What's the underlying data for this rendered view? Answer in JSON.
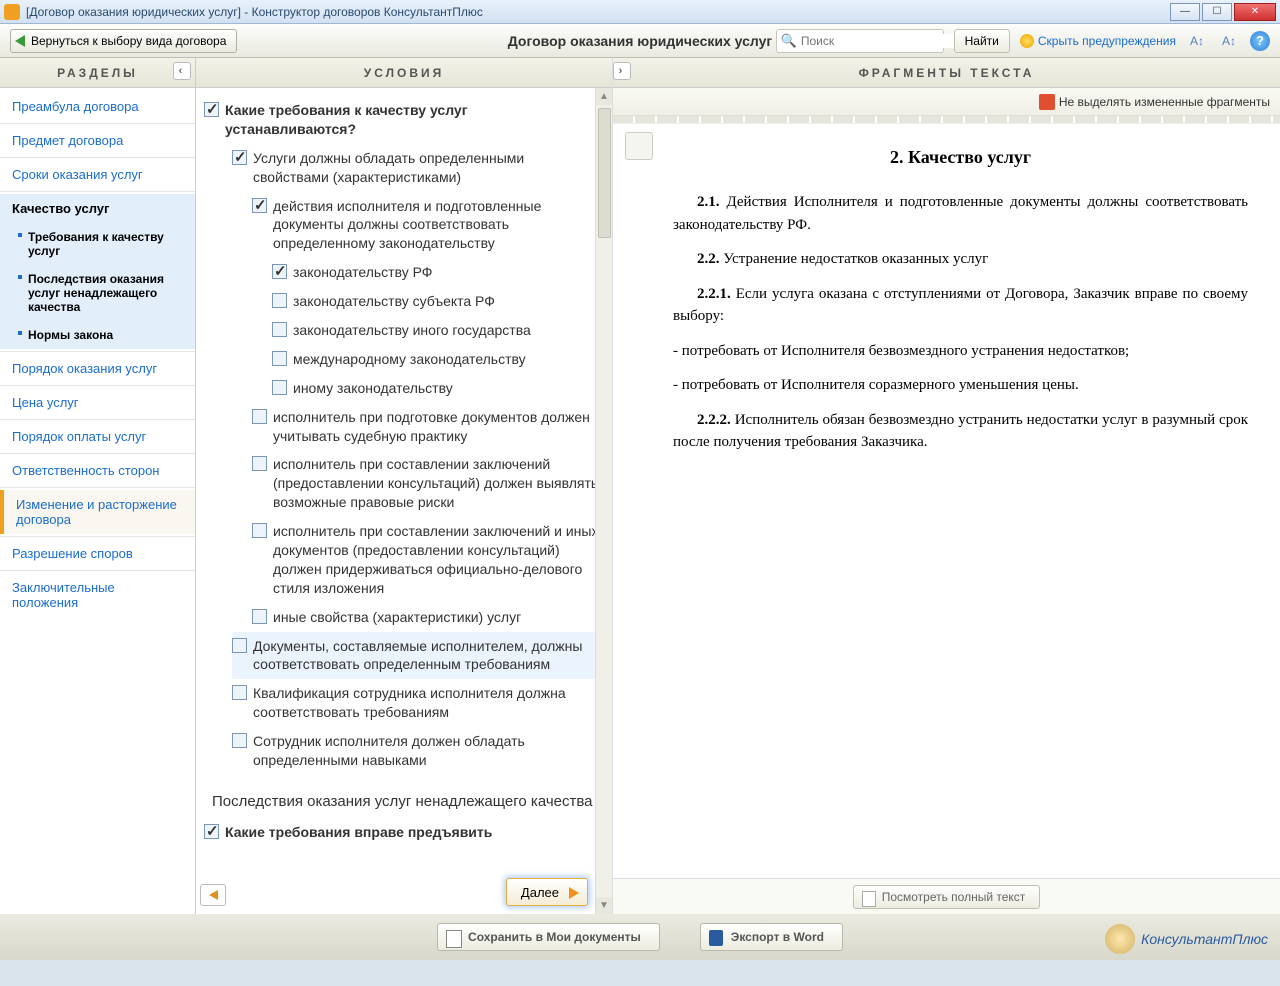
{
  "window": {
    "title": "[Договор оказания юридических услуг] - Конструктор договоров КонсультантПлюс"
  },
  "toolbar": {
    "back": "Вернуться к выбору вида договора",
    "title": "Договор оказания юридических услуг",
    "search_placeholder": "Поиск",
    "find": "Найти",
    "hide_warnings": "Скрыть предупреждения",
    "help": "?"
  },
  "panel_headers": {
    "sections": "РАЗДЕЛЫ",
    "conditions": "УСЛОВИЯ",
    "fragments": "ФРАГМЕНТЫ  ТЕКСТА"
  },
  "sections": [
    {
      "label": "Преамбула договора"
    },
    {
      "label": "Предмет договора"
    },
    {
      "label": "Сроки оказания услуг"
    },
    {
      "label": "Качество услуг",
      "active": true,
      "subs": [
        {
          "label": "Требования к качеству услуг"
        },
        {
          "label": "Последствия оказания услуг ненадлежащего качества"
        },
        {
          "label": "Нормы закона"
        }
      ]
    },
    {
      "label": "Порядок оказания услуг"
    },
    {
      "label": "Цена услуг"
    },
    {
      "label": "Порядок оплаты услуг"
    },
    {
      "label": "Ответственность сторон"
    },
    {
      "label": "Изменение и расторжение договора",
      "amend": true
    },
    {
      "label": "Разрешение споров"
    },
    {
      "label": "Заключительные положения"
    }
  ],
  "conditions": {
    "q1": {
      "label": "Какие требования к качеству услуг устанавливаются?",
      "checked": true,
      "bold": true,
      "indent": 0
    },
    "items": [
      {
        "label": "Услуги должны обладать определенными свойствами (характеристиками)",
        "checked": true,
        "indent": 1
      },
      {
        "label": "действия исполнителя и подготовленные документы должны соответствовать определенному законодательству",
        "checked": true,
        "indent": 2
      },
      {
        "label": "законодательству РФ",
        "checked": true,
        "indent": 3
      },
      {
        "label": "законодательству субъекта РФ",
        "checked": false,
        "indent": 3
      },
      {
        "label": "законодательству иного государства",
        "checked": false,
        "indent": 3
      },
      {
        "label": "международному законодательству",
        "checked": false,
        "indent": 3
      },
      {
        "label": "иному законодательству",
        "checked": false,
        "indent": 3
      },
      {
        "label": "исполнитель при подготовке документов должен учитывать судебную практику",
        "checked": false,
        "indent": 2
      },
      {
        "label": "исполнитель при составлении заключений (предоставлении консультаций) должен выявлять возможные правовые риски",
        "checked": false,
        "indent": 2
      },
      {
        "label": "исполнитель при составлении заключений и иных документов (предоставлении консультаций) должен придерживаться официально-делового стиля изложения",
        "checked": false,
        "indent": 2
      },
      {
        "label": "иные свойства (характеристики) услуг",
        "checked": false,
        "indent": 2
      },
      {
        "label": "Документы, составляемые исполнителем, должны соответствовать определенным требованиям",
        "checked": false,
        "indent": 1,
        "highlight": true
      },
      {
        "label": "Квалификация сотрудника исполнителя должна соответствовать требованиям",
        "checked": false,
        "indent": 1
      },
      {
        "label": "Сотрудник исполнителя должен обладать определенными навыками",
        "checked": false,
        "indent": 1
      }
    ],
    "heading2": "Последствия оказания услуг ненадлежащего качества",
    "q2": "Какие требования вправе предъявить",
    "next": "Далее"
  },
  "fragments": {
    "no_highlight": "Не выделять измененные фрагменты",
    "h": "2.  Качество услуг",
    "p21_num": "2.1.",
    "p21": "Действия Исполнителя и подготовленные документы должны соответствовать законодательству РФ.",
    "p22_num": "2.2.",
    "p22": "Устранение недостатков оказанных услуг",
    "p221_num": "2.2.1.",
    "p221": "Если услуга оказана с отступлениями от Договора, Заказчик вправе по своему выбору:",
    "b1": "-  потребовать от Исполнителя безвозмездного устранения недостатков;",
    "b2": "-  потребовать от Исполнителя соразмерного уменьшения цены.",
    "p222_num": "2.2.2.",
    "p222": "Исполнитель обязан безвозмездно устранить недостатки услуг в разумный срок после получения требования Заказчика.",
    "view_full": "Посмотреть полный текст"
  },
  "bottom": {
    "save": "Сохранить в Мои документы",
    "export": "Экспорт в Word",
    "brand": "КонсультантПлюс"
  }
}
